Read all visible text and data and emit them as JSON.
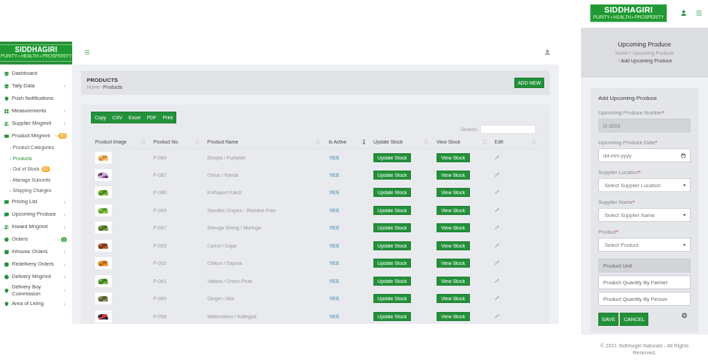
{
  "desktop": {
    "brand": {
      "name": "SIDDHAGIRI",
      "tagline": "PURITY • HEALTH • PROSPERITY"
    },
    "sidebar": {
      "items": [
        {
          "label": "Dashboard"
        },
        {
          "label": "Tally Data",
          "expanded": false
        },
        {
          "label": "Push Notifications"
        },
        {
          "label": "Measurements",
          "expanded": false
        },
        {
          "label": "Supplier Mngmnt",
          "expanded": false
        },
        {
          "label": "Product Mngmnt",
          "expanded": true,
          "badge": {
            "text": "50",
            "color": "#f5a623"
          },
          "children": [
            {
              "label": "- Product Categories",
              "selected": false
            },
            {
              "label": "- Products",
              "selected": true
            },
            {
              "label": "- Out of Stock",
              "selected": false,
              "badge": {
                "text": "50",
                "color": "#f5a623"
              }
            },
            {
              "label": "- Manage Subunits",
              "selected": false
            },
            {
              "label": "- Shipping Charges",
              "selected": false
            }
          ]
        },
        {
          "label": "Pricing List",
          "expanded": false
        },
        {
          "label": "Upcoming Produce",
          "expanded": false
        },
        {
          "label": "Inward Mngmnt",
          "expanded": false
        },
        {
          "label": "Orders",
          "expanded": false,
          "badge": {
            "text": "0",
            "color": "#2e9e3e"
          }
        },
        {
          "label": "Inhouse Orders",
          "expanded": false
        },
        {
          "label": "Redelivery Orders",
          "expanded": false
        },
        {
          "label": "Delivery Mngmnt",
          "expanded": false
        },
        {
          "label": "Delivery Boy Commission",
          "expanded": false
        },
        {
          "label": "Area of Living",
          "expanded": false
        }
      ]
    },
    "page": {
      "title": "PRODUCTS",
      "breadcrumb": [
        "Home",
        "Products"
      ],
      "add_button": "ADD NEW"
    },
    "export_buttons": [
      "Copy",
      "CSV",
      "Excel",
      "PDF",
      "Print"
    ],
    "search": {
      "label": "Search:"
    },
    "table": {
      "columns": [
        {
          "label": "Product Image",
          "sorted": false
        },
        {
          "label": "Product No.",
          "sorted": false
        },
        {
          "label": "Product Name",
          "sorted": false
        },
        {
          "label": "Is Active",
          "sorted": true
        },
        {
          "label": "Update Stock",
          "sorted": false
        },
        {
          "label": "View Stock",
          "sorted": false
        },
        {
          "label": "Edit",
          "sorted": false
        }
      ],
      "rows": [
        {
          "product_no": "P-089",
          "name": "Bhopla / Pumpkin",
          "active": "YES",
          "update": "Update Stock",
          "view": "View Stock"
        },
        {
          "product_no": "P-087",
          "name": "Onion / Kanda",
          "active": "YES",
          "update": "Update Stock",
          "view": "View Stock"
        },
        {
          "product_no": "P-086",
          "name": "Kolhapuri Kakdi",
          "active": "YES",
          "update": "Update Stock",
          "view": "View Stock"
        },
        {
          "product_no": "P-069",
          "name": "Seedles Grapes - Residue Free",
          "active": "YES",
          "update": "Update Stock",
          "view": "View Stock"
        },
        {
          "product_no": "P-067",
          "name": "Shevga Sheng / Moringa",
          "active": "YES",
          "update": "Update Stock",
          "view": "View Stock"
        },
        {
          "product_no": "P-063",
          "name": "Carrot / Gajar",
          "active": "YES",
          "update": "Update Stock",
          "view": "View Stock"
        },
        {
          "product_no": "P-062",
          "name": "Chikoo / Sapota",
          "active": "YES",
          "update": "Update Stock",
          "view": "View Stock"
        },
        {
          "product_no": "P-061",
          "name": "Vatana / Green Peas",
          "active": "YES",
          "update": "Update Stock",
          "view": "View Stock"
        },
        {
          "product_no": "P-060",
          "name": "Ginger / Alla",
          "active": "YES",
          "update": "Update Stock",
          "view": "View Stock"
        },
        {
          "product_no": "P-058",
          "name": "Watermelon / Kalingad",
          "active": "YES",
          "update": "Update Stock",
          "view": "View Stock"
        }
      ]
    }
  },
  "mobile": {
    "brand": {
      "name": "SIDDHAGIRI",
      "tagline": "PURITY • HEALTH • PROSPERITY"
    },
    "header": {
      "title": "Upcoming Produce",
      "breadcrumb": [
        "Home",
        "Upcoming Produce",
        "Add Upcoming Produce"
      ]
    },
    "form": {
      "title": "Add Upcoming Produce",
      "fields": [
        {
          "kind": "text",
          "label": "Upcoming Produce Number",
          "required_mark": "*",
          "value": "U-1010",
          "disabled": true
        },
        {
          "kind": "date",
          "label": "Upcoming Produce Date",
          "required_mark": "*",
          "placeholder": "dd-mm-yyyy",
          "disabled": false
        },
        {
          "kind": "select",
          "label": "Supplier Location",
          "required_mark": "*",
          "placeholder": "Select Supplier Location",
          "disabled": false
        },
        {
          "kind": "select",
          "label": "Supplier Name",
          "required_mark": "*",
          "placeholder": "Select Supplier Name",
          "disabled": false
        },
        {
          "kind": "select",
          "label": "Product",
          "required_mark": "*",
          "placeholder": "Select Product",
          "disabled": false
        },
        {
          "kind": "text",
          "placeholder": "Product Unit",
          "disabled": true
        },
        {
          "kind": "text",
          "placeholder": "Product Quantity By Farmer",
          "disabled": false
        },
        {
          "kind": "text",
          "placeholder": "Product Quantity By Person",
          "disabled": false
        }
      ],
      "buttons": [
        "SAVE",
        "CANCEL"
      ]
    },
    "footer": "© 2021 Sidhhagiri Naturals - All Rights Reserved."
  }
}
